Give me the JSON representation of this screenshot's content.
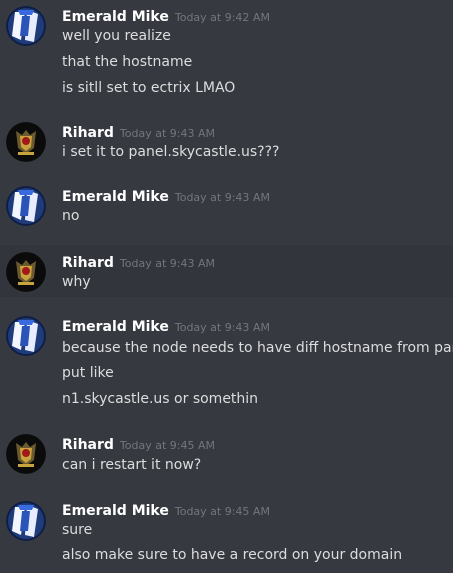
{
  "users": {
    "mike": {
      "name": "Emerald Mike"
    },
    "rihard": {
      "name": "Rihard"
    }
  },
  "colors": {
    "background": "#36393f",
    "hover_background": "#32353b",
    "username": "#ffffff",
    "timestamp": "#72767d",
    "message_text": "#dcddde"
  },
  "messages": [
    {
      "author": "Emerald Mike",
      "timestamp": "Today at 9:42 AM",
      "lines": [
        "well you realize",
        "that the hostname",
        "is sitll set to ectrix LMAO"
      ]
    },
    {
      "author": "Rihard",
      "timestamp": "Today at 9:43 AM",
      "lines": [
        "i set it to panel.skycastle.us???"
      ]
    },
    {
      "author": "Emerald Mike",
      "timestamp": "Today at 9:43 AM",
      "lines": [
        "no"
      ]
    },
    {
      "author": "Rihard",
      "timestamp": "Today at 9:43 AM",
      "lines": [
        "why"
      ]
    },
    {
      "author": "Emerald Mike",
      "timestamp": "Today at 9:43 AM",
      "lines": [
        "because the node needs to have diff hostname from panel",
        "put like",
        "n1.skycastle.us or somethin"
      ]
    },
    {
      "author": "Rihard",
      "timestamp": "Today at 9:45 AM",
      "lines": [
        "can i restart it now?"
      ]
    },
    {
      "author": "Emerald Mike",
      "timestamp": "Today at 9:45 AM",
      "lines": [
        "sure",
        "also make sure to have a record on your domain"
      ]
    }
  ]
}
